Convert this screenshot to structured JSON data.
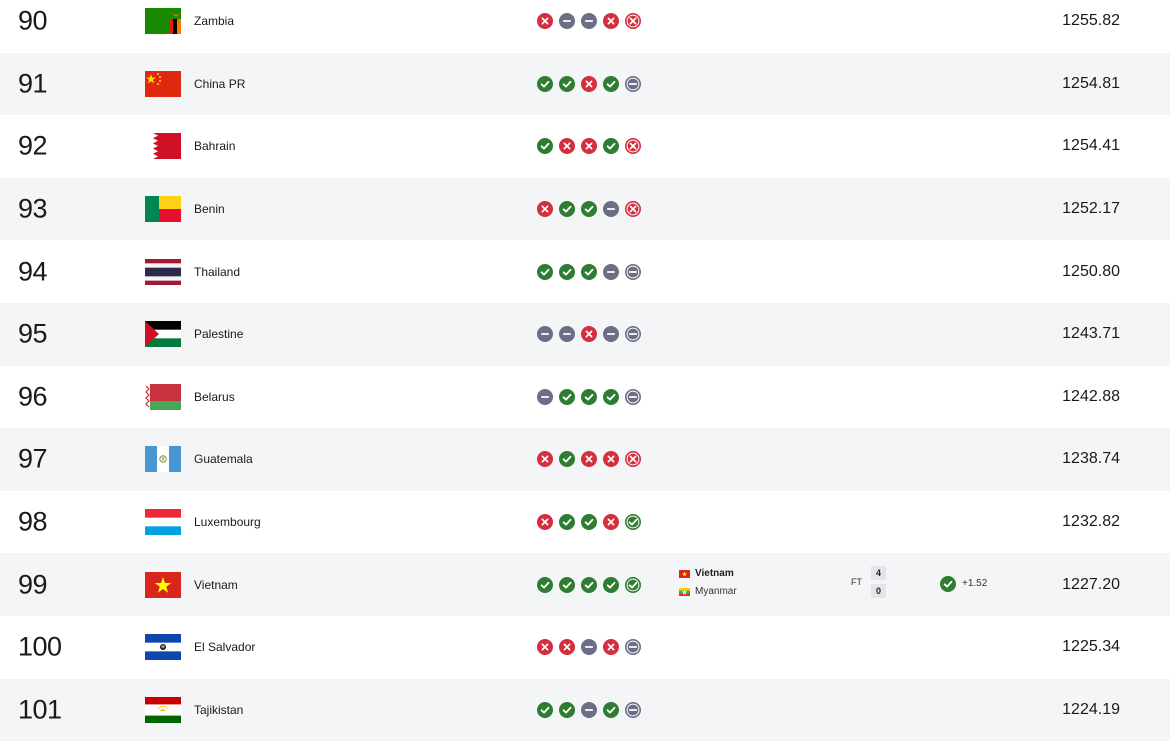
{
  "colors": {
    "win": "#2e7d32",
    "loss": "#d32f3f",
    "draw": "#6b6e85",
    "alt_row": "#f4f5f7"
  },
  "rows": [
    {
      "rank": "90",
      "flag": "zambia",
      "team": "Zambia",
      "form": [
        "L",
        "D",
        "D",
        "L",
        "L-ring"
      ],
      "points": "1255.82"
    },
    {
      "rank": "91",
      "flag": "china",
      "team": "China PR",
      "form": [
        "W",
        "W",
        "L",
        "W",
        "D-ring"
      ],
      "points": "1254.81"
    },
    {
      "rank": "92",
      "flag": "bahrain",
      "team": "Bahrain",
      "form": [
        "W",
        "L",
        "L",
        "W",
        "L-ring"
      ],
      "points": "1254.41"
    },
    {
      "rank": "93",
      "flag": "benin",
      "team": "Benin",
      "form": [
        "L",
        "W",
        "W",
        "D",
        "L-ring"
      ],
      "points": "1252.17"
    },
    {
      "rank": "94",
      "flag": "thailand",
      "team": "Thailand",
      "form": [
        "W",
        "W",
        "W",
        "D",
        "D-ring"
      ],
      "points": "1250.80"
    },
    {
      "rank": "95",
      "flag": "palestine",
      "team": "Palestine",
      "form": [
        "D",
        "D",
        "L",
        "D",
        "D-ring"
      ],
      "points": "1243.71"
    },
    {
      "rank": "96",
      "flag": "belarus",
      "team": "Belarus",
      "form": [
        "D",
        "W",
        "W",
        "W",
        "D-ring"
      ],
      "points": "1242.88"
    },
    {
      "rank": "97",
      "flag": "guatemala",
      "team": "Guatemala",
      "form": [
        "L",
        "W",
        "L",
        "L",
        "L-ring"
      ],
      "points": "1238.74"
    },
    {
      "rank": "98",
      "flag": "luxembourg",
      "team": "Luxembourg",
      "form": [
        "L",
        "W",
        "W",
        "L",
        "W-ring"
      ],
      "points": "1232.82"
    },
    {
      "rank": "99",
      "flag": "vietnam",
      "team": "Vietnam",
      "form": [
        "W",
        "W",
        "W",
        "W",
        "W-ring"
      ],
      "points": "1227.20",
      "match": {
        "home": "Vietnam",
        "away": "Myanmar",
        "status": "FT",
        "home_score": "4",
        "away_score": "0",
        "change": "+1.52"
      }
    },
    {
      "rank": "100",
      "flag": "el-salvador",
      "team": "El Salvador",
      "form": [
        "L",
        "L",
        "D",
        "L",
        "D-ring"
      ],
      "points": "1225.34"
    },
    {
      "rank": "101",
      "flag": "tajikistan",
      "team": "Tajikistan",
      "form": [
        "W",
        "W",
        "D",
        "W",
        "D-ring"
      ],
      "points": "1224.19"
    }
  ]
}
